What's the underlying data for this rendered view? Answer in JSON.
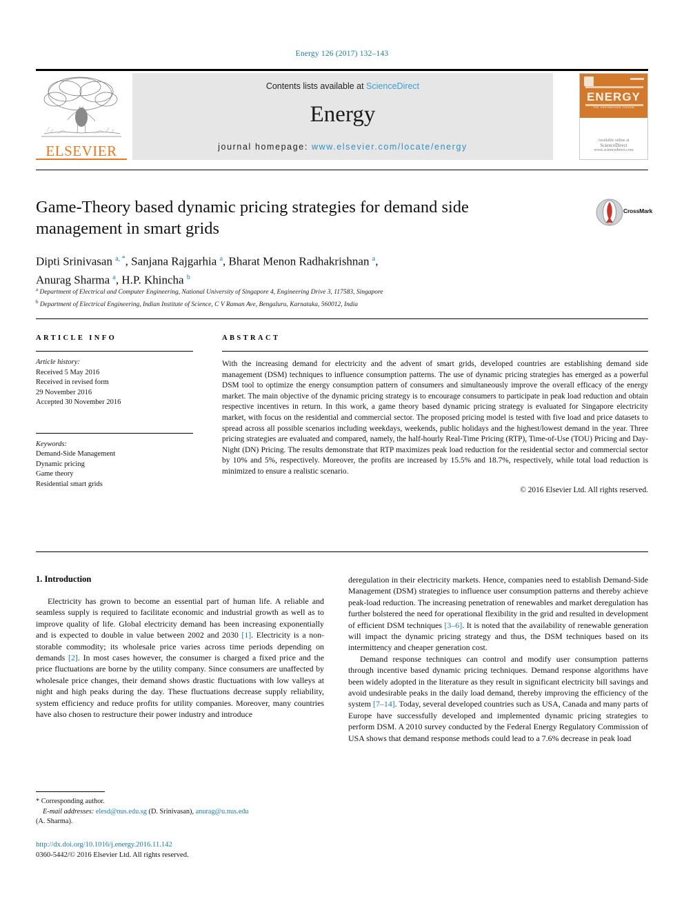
{
  "running_head": "Energy 126 (2017) 132–143",
  "masthead": {
    "contents_prefix": "Contents lists available at ",
    "sciencedirect": "ScienceDirect",
    "journal_name": "Energy",
    "homepage_prefix": "journal homepage: ",
    "homepage_url": "www.elsevier.com/locate/energy",
    "publisher_wordmark": "ELSEVIER",
    "cover": {
      "title": "ENERGY",
      "subtitle": "The international Journal",
      "footer_prefix": "Available online at",
      "footer_brand": "ScienceDirect",
      "footer_url": "www.sciencedirect.com"
    }
  },
  "article": {
    "title": "Game-Theory based dynamic pricing strategies for demand side management in smart grids",
    "crossmark_label": "CrossMark",
    "authors_line1_a": "Dipti Srinivasan ",
    "authors_line1_sup_a": "a, *",
    "authors_line1_b": ", Sanjana Rajgarhia ",
    "authors_line1_sup_b": "a",
    "authors_line1_c": ", Bharat Menon Radhakrishnan ",
    "authors_line1_sup_c": "a",
    "authors_line1_d": ",",
    "authors_line2_a": "Anurag Sharma ",
    "authors_line2_sup_a": "a",
    "authors_line2_b": ", H.P. Khincha ",
    "authors_line2_sup_b": "b",
    "affiliation_a_marker": "a",
    "affiliation_a": " Department of Electrical and Computer Engineering, National University of Singapore 4, Engineering Drive 3, 117583, Singapore",
    "affiliation_b_marker": "b",
    "affiliation_b": " Department of Electrical Engineering, Indian Institute of Science, C V Raman Ave, Bengaluru, Karnataka, 560012, India"
  },
  "article_info": {
    "heading": "ARTICLE INFO",
    "history_label": "Article history:",
    "history_lines": [
      "Received 5 May 2016",
      "Received in revised form",
      "29 November 2016",
      "Accepted 30 November 2016"
    ],
    "keywords_label": "Keywords:",
    "keywords": [
      "Demand-Side Management",
      "Dynamic pricing",
      "Game theory",
      "Residential smart grids"
    ]
  },
  "abstract": {
    "heading": "ABSTRACT",
    "text": "With the increasing demand for electricity and the advent of smart grids, developed countries are establishing demand side management (DSM) techniques to influence consumption patterns. The use of dynamic pricing strategies has emerged as a powerful DSM tool to optimize the energy consumption pattern of consumers and simultaneously improve the overall efficacy of the energy market. The main objective of the dynamic pricing strategy is to encourage consumers to participate in peak load reduction and obtain respective incentives in return. In this work, a game theory based dynamic pricing strategy is evaluated for Singapore electricity market, with focus on the residential and commercial sector. The proposed pricing model is tested with five load and price datasets to spread across all possible scenarios including weekdays, weekends, public holidays and the highest/lowest demand in the year. Three pricing strategies are evaluated and compared, namely, the half-hourly Real-Time Pricing (RTP), Time-of-Use (TOU) Pricing and Day-Night (DN) Pricing. The results demonstrate that RTP maximizes peak load reduction for the residential sector and commercial sector by 10% and 5%, respectively. Moreover, the profits are increased by 15.5% and 18.7%, respectively, while total load reduction is minimized to ensure a realistic scenario.",
    "copyright": "© 2016 Elsevier Ltd. All rights reserved."
  },
  "body": {
    "section_number_title": "1. Introduction",
    "left_p1_a": "Electricity has grown to become an essential part of human life. A reliable and seamless supply is required to facilitate economic and industrial growth as well as to improve quality of life. Global electricity demand has been increasing exponentially and is expected to double in value between 2002 and 2030 ",
    "left_p1_ref1": "[1]",
    "left_p1_b": ". Electricity is a non-storable commodity; its wholesale price varies across time periods depending on demands ",
    "left_p1_ref2": "[2]",
    "left_p1_c": ". In most cases however, the consumer is charged a fixed price and the price fluctuations are borne by the utility company. Since consumers are unaffected by wholesale price changes, their demand shows drastic fluctuations with low valleys at night and high peaks during the day. These fluctuations decrease supply reliability, system efficiency and reduce profits for utility companies. Moreover, many countries have also chosen to restructure their power industry and introduce",
    "right_p1_a": "deregulation in their electricity markets. Hence, companies need to establish Demand-Side Management (DSM) strategies to influence user consumption patterns and thereby achieve peak-load reduction. The increasing penetration of renewables and market deregulation has further bolstered the need for operational flexibility in the grid and resulted in development of efficient DSM techniques ",
    "right_p1_ref": "[3–6]",
    "right_p1_b": ". It is noted that the availability of renewable generation will impact the dynamic pricing strategy and thus, the DSM techniques based on its intermittency and cheaper generation cost.",
    "right_p2_a": "Demand response techniques can control and modify user consumption patterns through incentive based dynamic pricing techniques. Demand response algorithms have been widely adopted in the literature as they result in significant electricity bill savings and avoid undesirable peaks in the daily load demand, thereby improving the efficiency of the system ",
    "right_p2_ref": "[7–14]",
    "right_p2_b": ". Today, several developed countries such as USA, Canada and many parts of Europe have successfully developed and implemented dynamic pricing strategies to perform DSM. A 2010 survey conducted by the Federal Energy Regulatory Commission of USA shows that demand response methods could lead to a 7.6% decrease in peak load"
  },
  "footer": {
    "corresponding_marker": "*",
    "corresponding_label": " Corresponding author.",
    "email_label": "E-mail addresses:",
    "email1": "elesd@nus.edu.sg",
    "email1_owner": " (D. Srinivasan), ",
    "email2": "anurag@u.nus.edu",
    "email2_owner": "(A. Sharma).",
    "doi": "http://dx.doi.org/10.1016/j.energy.2016.11.142",
    "issn_line": "0360-5442/© 2016 Elsevier Ltd. All rights reserved."
  },
  "colors": {
    "link": "#1a7aa8",
    "elsevier_orange": "#E87722",
    "masthead_bg": "#e6e6e6",
    "cover_orange": "#d2792c",
    "crossmark_red": "#c8352a"
  }
}
